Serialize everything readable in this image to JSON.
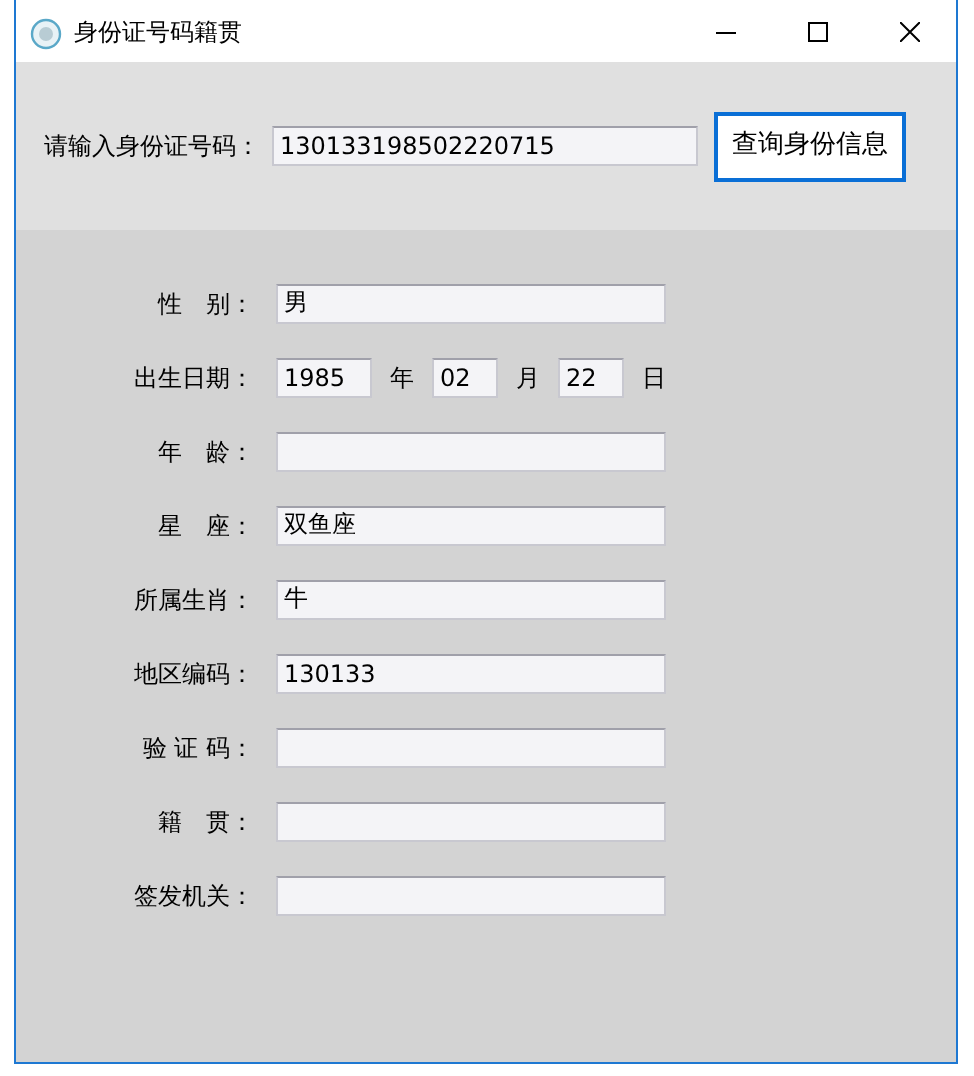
{
  "window": {
    "title": "身份证号码籍贯"
  },
  "query": {
    "label": "请输入身份证号码：",
    "value": "130133198502220715",
    "button": "查询身份信息",
    "button_focused": true
  },
  "fields": [
    {
      "kind": "text",
      "label": "性　别：",
      "value": "男"
    },
    {
      "kind": "date",
      "label": "出生日期：",
      "year": "1985",
      "year_unit": "年",
      "month": "02",
      "month_unit": "月",
      "day": "22",
      "day_unit": "日"
    },
    {
      "kind": "text",
      "label": "年　龄："
    },
    {
      "kind": "text",
      "label": "星　座：",
      "value": "双鱼座"
    },
    {
      "kind": "text",
      "label": "所属生肖：",
      "value": "牛"
    },
    {
      "kind": "text",
      "label": "地区编码：",
      "value": "130133"
    },
    {
      "kind": "text",
      "label": "验 证 码："
    },
    {
      "kind": "text",
      "label": "籍　贯："
    },
    {
      "kind": "text",
      "label": "签发机关："
    }
  ]
}
